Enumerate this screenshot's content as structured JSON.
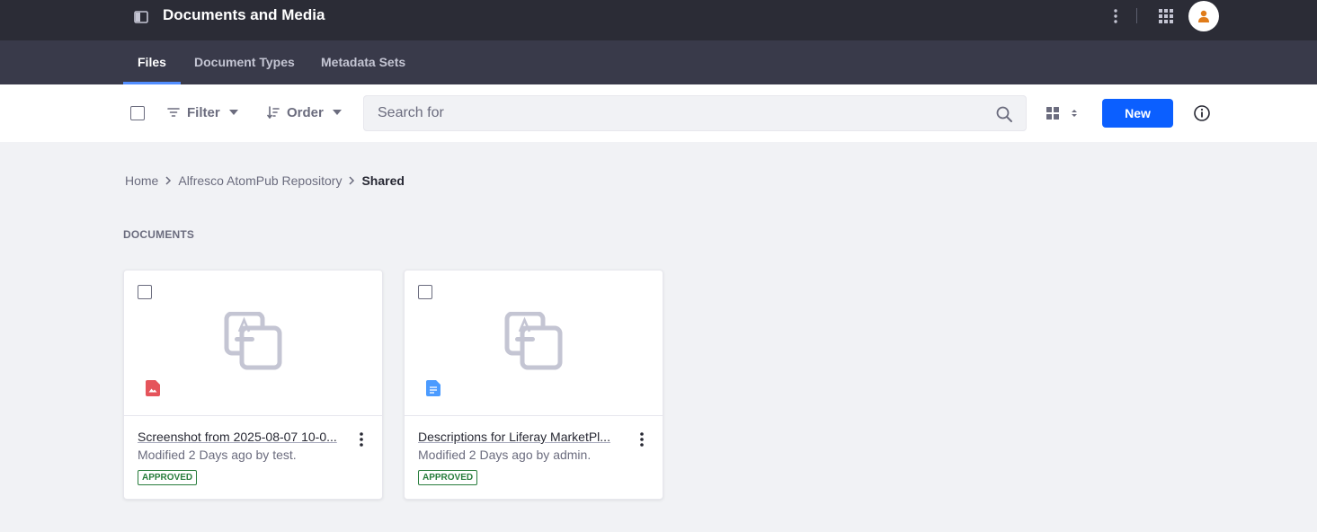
{
  "app": {
    "title": "Documents and Media",
    "icons": {
      "sidebar": "sidebar-toggle-icon",
      "options": "ellipsis-v-icon",
      "apps": "grid-apps-icon",
      "user": "user-avatar-icon"
    }
  },
  "tabs": [
    {
      "label": "Files",
      "active": true
    },
    {
      "label": "Document Types",
      "active": false
    },
    {
      "label": "Metadata Sets",
      "active": false
    }
  ],
  "toolbar": {
    "filter_label": "Filter",
    "order_label": "Order",
    "search_placeholder": "Search for",
    "search_value": "",
    "new_label": "New",
    "display_style": "cards"
  },
  "breadcrumb": {
    "items": [
      "Home",
      "Alfresco AtomPub Repository",
      "Shared"
    ]
  },
  "section": {
    "title": "DOCUMENTS"
  },
  "documents": [
    {
      "title": "Screenshot from 2025-08-07 10-0...",
      "subtitle": "Modified 2 Days ago by test.",
      "status": "APPROVED",
      "file_type_icon": "image-file-icon",
      "file_type_color": "#e5545b"
    },
    {
      "title": "Descriptions for Liferay MarketPl...",
      "subtitle": "Modified 2 Days ago by admin.",
      "status": "APPROVED",
      "file_type_icon": "text-document-icon",
      "file_type_color": "#4b9bff"
    }
  ],
  "colors": {
    "topbar": "#2b2c36",
    "tabbar": "#393a4a",
    "accent": "#0b5fff",
    "tab_indicator": "#528eff",
    "approved": "#287d3c",
    "avatar_icon": "#e07c1a"
  }
}
